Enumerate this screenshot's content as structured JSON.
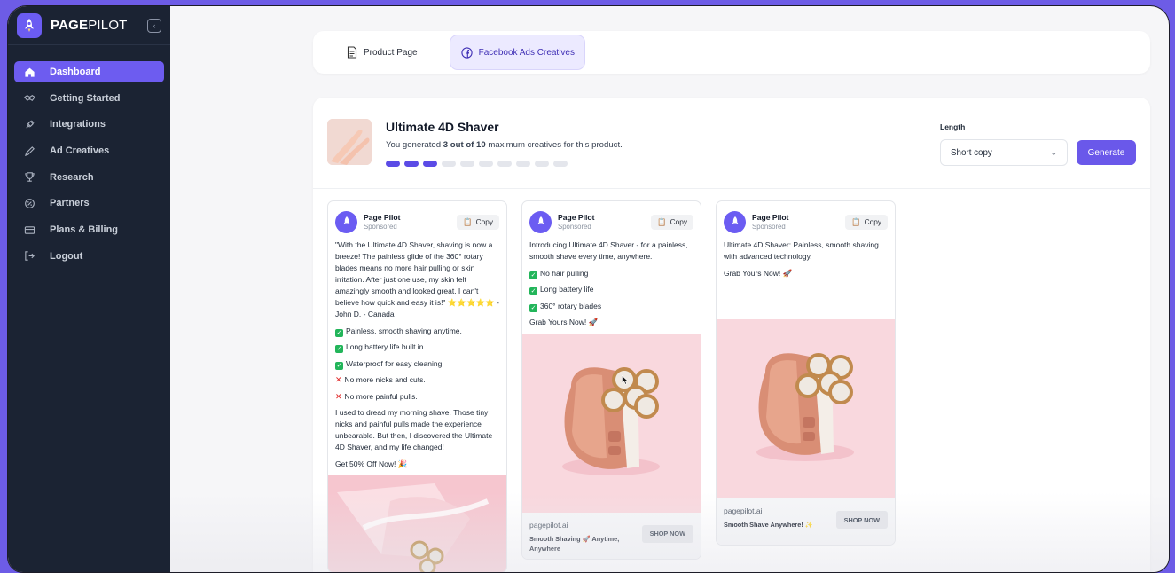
{
  "brand": {
    "name_bold": "PAGE",
    "name_light": "PILOT"
  },
  "sidebar": {
    "items": [
      {
        "label": "Dashboard",
        "icon": "home-icon",
        "active": true
      },
      {
        "label": "Getting Started",
        "icon": "handshake-icon"
      },
      {
        "label": "Integrations",
        "icon": "plug-icon"
      },
      {
        "label": "Ad Creatives",
        "icon": "pen-icon"
      },
      {
        "label": "Research",
        "icon": "trophy-icon"
      },
      {
        "label": "Partners",
        "icon": "badge-icon"
      },
      {
        "label": "Plans & Billing",
        "icon": "card-icon"
      },
      {
        "label": "Logout",
        "icon": "logout-icon"
      }
    ]
  },
  "tabs": [
    {
      "label": "Product Page",
      "icon": "document-icon",
      "active": false
    },
    {
      "label": "Facebook Ads Creatives",
      "icon": "facebook-icon",
      "active": true
    }
  ],
  "product": {
    "title": "Ultimate 4D Shaver",
    "sub_prefix": "You generated ",
    "sub_bold": "3 out of 10",
    "sub_suffix": " maximum creatives for this product.",
    "generated": 3,
    "maximum": 10
  },
  "controls": {
    "length_label": "Length",
    "length_value": "Short copy",
    "generate_label": "Generate"
  },
  "ads": [
    {
      "page_name": "Page Pilot",
      "sponsored": "Sponsored",
      "copy_label": "Copy",
      "intro": "\"With the Ultimate 4D Shaver, shaving is now a breeze! The painless glide of the 360° rotary blades means no more hair pulling or skin irritation. After just one use, my skin felt amazingly smooth and looked great. I can't believe how quick and easy it is!\" ⭐⭐⭐⭐⭐ - John D. - Canada",
      "checks": [
        "Painless, smooth shaving anytime.",
        "Long battery life built in.",
        "Waterproof for easy cleaning."
      ],
      "crosses": [
        "No more nicks and cuts.",
        "No more painful pulls."
      ],
      "story": "I used to dread my morning shave. Those tiny nicks and painful pulls made the experience unbearable. But then, I discovered the Ultimate 4D Shaver, and my life changed!",
      "cta": "Get 50% Off Now! 🎉"
    },
    {
      "page_name": "Page Pilot",
      "sponsored": "Sponsored",
      "copy_label": "Copy",
      "intro": "Introducing Ultimate 4D Shaver - for a painless, smooth shave every time, anywhere.",
      "checks": [
        "No hair pulling",
        "Long battery life",
        "360° rotary blades"
      ],
      "cta": "Grab Yours Now! 🚀",
      "foot_url": "pagepilot.ai",
      "foot_text": "Smooth Shaving 🚀 Anytime, Anywhere",
      "shop_label": "SHOP NOW"
    },
    {
      "page_name": "Page Pilot",
      "sponsored": "Sponsored",
      "copy_label": "Copy",
      "intro": "Ultimate 4D Shaver: Painless, smooth shaving with advanced technology.",
      "cta": "Grab Yours Now! 🚀",
      "foot_url": "pagepilot.ai",
      "foot_text": "Smooth Shave Anywhere! ✨",
      "shop_label": "SHOP NOW"
    }
  ],
  "colors": {
    "accent": "#6a58ea",
    "sidebar_bg": "#1b2333",
    "image_bg": "#f9d8de"
  }
}
